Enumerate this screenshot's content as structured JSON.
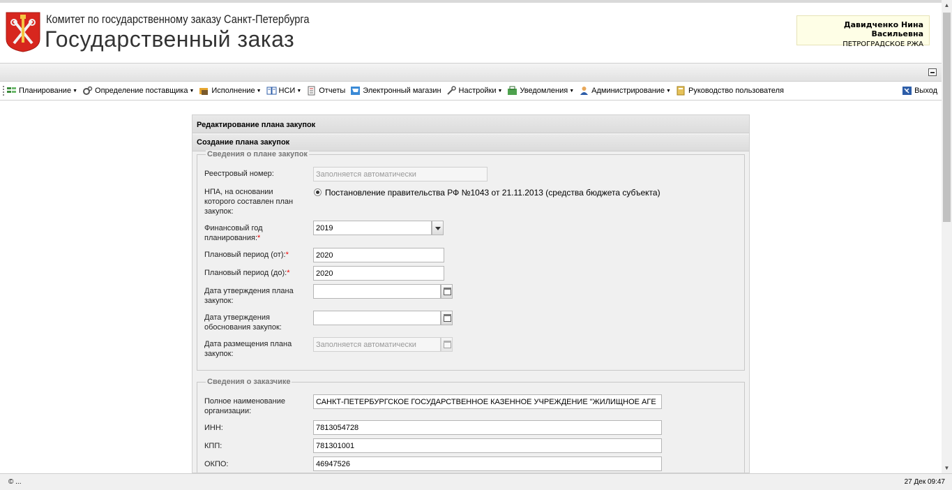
{
  "header": {
    "org_line": "Комитет по государственному заказу Санкт-Петербурга",
    "app_title": "Государственный заказ",
    "user_name": "Давидченко Нина Васильевна",
    "user_org": "ПЕТРОГРАДСКОЕ РЖА"
  },
  "menu": [
    {
      "label": "Планирование",
      "icon": "planning-icon",
      "dropdown": true
    },
    {
      "label": "Определение поставщика",
      "icon": "gears-icon",
      "dropdown": true
    },
    {
      "label": "Исполнение",
      "icon": "execution-icon",
      "dropdown": true
    },
    {
      "label": "НСИ",
      "icon": "book-icon",
      "dropdown": true
    },
    {
      "label": "Отчеты",
      "icon": "report-icon",
      "dropdown": false
    },
    {
      "label": "Электронный магазин",
      "icon": "cart-icon",
      "dropdown": false
    },
    {
      "label": "Настройки",
      "icon": "wrench-icon",
      "dropdown": true
    },
    {
      "label": "Уведомления",
      "icon": "notification-icon",
      "dropdown": true
    },
    {
      "label": "Администрирование",
      "icon": "user-icon",
      "dropdown": true
    },
    {
      "label": "Руководство пользователя",
      "icon": "manual-icon",
      "dropdown": false
    }
  ],
  "exit_label": "Выход",
  "panel": {
    "title": "Редактирование плана закупок",
    "subtitle": "Создание плана закупок"
  },
  "plan_section": {
    "legend": "Сведения о плане закупок",
    "registry_label": "Реестровый номер:",
    "registry_placeholder": "Заполняется автоматически",
    "npa_label": "НПА, на основании которого составлен план закупок:",
    "npa_option": "Постановление правительства РФ №1043 от 21.11.2013 (средства бюджета субъекта)",
    "fin_year_label": "Финансовый год планирования:",
    "fin_year_value": "2019",
    "period_from_label": "Плановый период (от):",
    "period_from_value": "2020",
    "period_to_label": "Плановый период (до):",
    "period_to_value": "2020",
    "approve_plan_label": "Дата утверждения плана закупок:",
    "approve_reason_label": "Дата утверждения обоснования закупок:",
    "publish_label": "Дата размещения плана закупок:",
    "publish_placeholder": "Заполняется автоматически",
    "required_mark": "*"
  },
  "customer_section": {
    "legend": "Сведения о заказчике",
    "full_name_label": "Полное наименование организации:",
    "full_name_value": "САНКТ-ПЕТЕРБУРГСКОЕ ГОСУДАРСТВЕННОЕ КАЗЕННОЕ УЧРЕЖДЕНИЕ \"ЖИЛИЩНОЕ АГЕ",
    "inn_label": "ИНН:",
    "inn_value": "7813054728",
    "kpp_label": "КПП:",
    "kpp_value": "781301001",
    "okpo_label": "ОКПО:",
    "okpo_value": "46947526"
  },
  "status": {
    "left": "© ...",
    "right": "27 Дек 09:47"
  },
  "colors": {
    "brand_red": "#d7261e",
    "required": "#ee0000"
  }
}
